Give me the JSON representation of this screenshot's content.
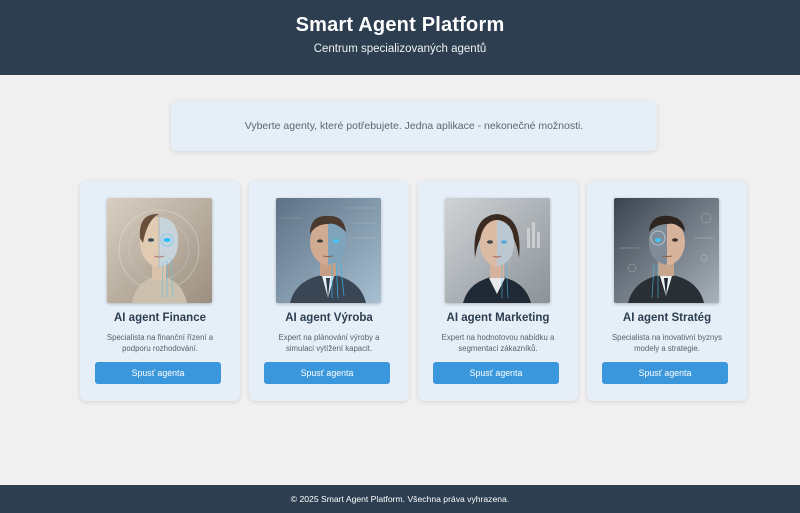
{
  "header": {
    "title": "Smart Agent Platform",
    "subtitle": "Centrum specializovaných agentů"
  },
  "intro": {
    "text": "Vyberte agenty, které potřebujete. Jedna aplikace - nekonečné možnosti."
  },
  "agents": [
    {
      "name": "AI agent Finance",
      "description": "Specialista na finanční řízení a podporu rozhodování.",
      "button_label": "Spusť agenta",
      "portrait_icon": "female-android-portrait"
    },
    {
      "name": "AI agent Výroba",
      "description": "Expert na plánování výroby a simulaci vytížení kapacit.",
      "button_label": "Spusť agenta",
      "portrait_icon": "male-cyborg-portrait"
    },
    {
      "name": "AI agent Marketing",
      "description": "Expert na hodnotovou nabídku a segmentaci zákazníků.",
      "button_label": "Spusť agenta",
      "portrait_icon": "female-cyborg-portrait"
    },
    {
      "name": "AI agent Stratég",
      "description": "Specialista na inovativní byznys modely a strategie.",
      "button_label": "Spusť agenta",
      "portrait_icon": "male-android-portrait"
    }
  ],
  "footer": {
    "text": "© 2025 Smart Agent Platform. Všechna práva vyhrazena."
  },
  "colors": {
    "header_bg": "#2c3e50",
    "page_bg": "#f0f0f0",
    "card_bg": "#e6eff8",
    "button_bg": "#3b97db",
    "title_text": "#2c3e50"
  }
}
